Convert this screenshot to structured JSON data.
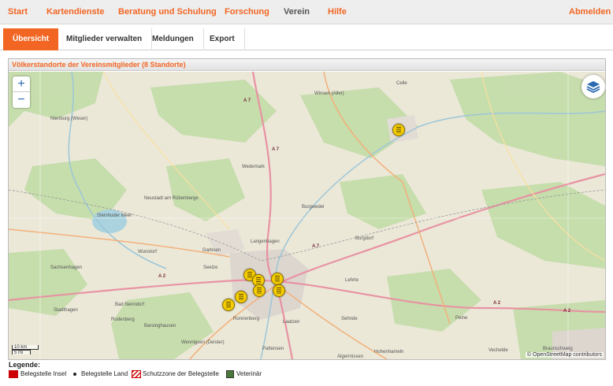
{
  "nav": {
    "items": [
      "Start",
      "Kartendienste",
      "Beratung und Schulung",
      "Forschung",
      "Verein",
      "Hilfe"
    ],
    "logout": "Abmelden",
    "active": "Verein"
  },
  "tabs": {
    "items": [
      "Übersicht",
      "Mitglieder verwalten",
      "Meldungen",
      "Export"
    ],
    "active": "Übersicht"
  },
  "panel": {
    "title": "Völkerstandorte der Vereinsmitglieder (8 Standorte)"
  },
  "map": {
    "zoom_in": "+",
    "zoom_out": "−",
    "attribution": "© OpenStreetMap contributors",
    "scale_km": "10 km",
    "scale_mi": "5 mi",
    "labels": [
      "Nienburg (Weser)",
      "Winsen (Aller)",
      "Celle",
      "Wedemark",
      "Burgwedel",
      "Neustadt am Rübenberge",
      "Langenhagen",
      "Garbsen",
      "Wunstorf",
      "Seelze",
      "Sachsenhagen",
      "Burgdorf",
      "Lehrte",
      "Bad Nenndorf",
      "Stadthagen",
      "Rodenberg",
      "Barsinghausen",
      "Ronnenberg",
      "Laatzen",
      "Sehnde",
      "Wennigsen (Deister)",
      "Pattensen",
      "Braunschweig",
      "Peine",
      "Steinhuder Meer",
      "Hohenhameln",
      "Vechelde",
      "Algermissen"
    ],
    "road_labels": [
      "A 7",
      "A 2",
      "A 7",
      "A 2",
      "A 2",
      "A 7"
    ],
    "standorte_count": 8
  },
  "legend": {
    "title": "Legende:",
    "items": [
      {
        "label": "Belegstelle Insel",
        "color": "#cc0000"
      },
      {
        "label": "Belegstelle Land",
        "color": "#222222"
      },
      {
        "label": "Schutzzone der Belegstelle",
        "color": "#cc0000"
      },
      {
        "label": "Veterinär",
        "color": "#4a7a3a"
      }
    ]
  },
  "colors": {
    "accent": "#f26522",
    "marker": "#f5cc00"
  }
}
